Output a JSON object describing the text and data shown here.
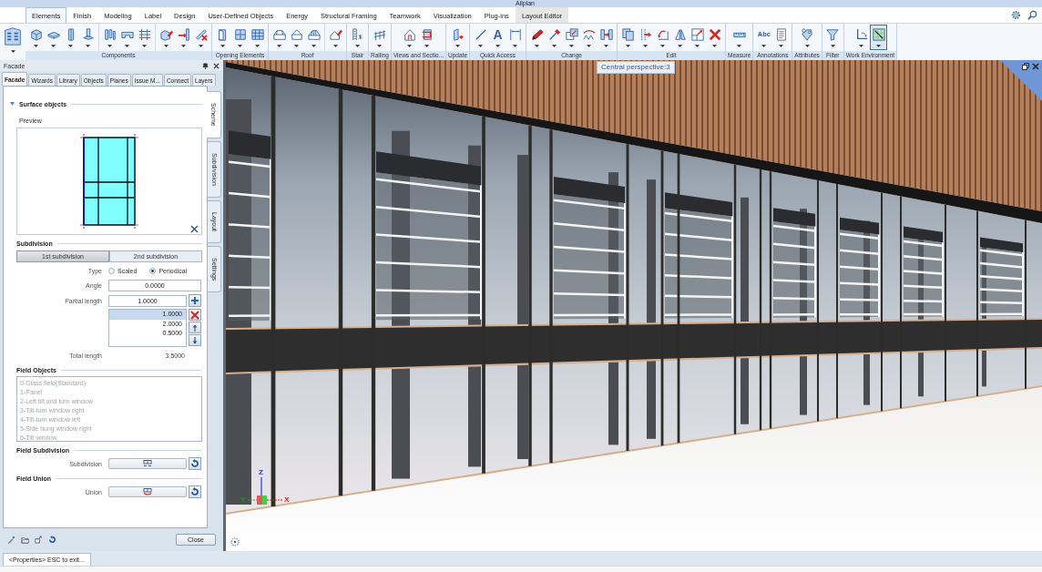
{
  "window": {
    "title": "Allplan"
  },
  "menu_tabs": [
    {
      "label": "Elements",
      "selected": true,
      "kind": "standard"
    },
    {
      "label": "Finish",
      "selected": false,
      "kind": "standard"
    },
    {
      "label": "Modeling",
      "selected": false,
      "kind": "standard"
    },
    {
      "label": "Label",
      "selected": false,
      "kind": "standard"
    },
    {
      "label": "Design",
      "selected": false,
      "kind": "standard"
    },
    {
      "label": "User-Defined Objects",
      "selected": false,
      "kind": "standard"
    },
    {
      "label": "Energy",
      "selected": false,
      "kind": "standard"
    },
    {
      "label": "Structural Framing",
      "selected": false,
      "kind": "standard"
    },
    {
      "label": "Teamwork",
      "selected": false,
      "kind": "standard"
    },
    {
      "label": "Visualization",
      "selected": false,
      "kind": "standard"
    },
    {
      "label": "Plug-ins",
      "selected": false,
      "kind": "standard"
    },
    {
      "label": "Layout Editor",
      "selected": false,
      "kind": "contextual"
    }
  ],
  "ribbon": {
    "groups": [
      {
        "label": "Components",
        "sets": [
          [
            {
              "selected": false
            },
            {
              "selected": false
            },
            {
              "selected": false
            },
            {
              "selected": false
            }
          ],
          [
            {
              "selected": false
            },
            {
              "selected": false
            },
            {
              "selected": false
            }
          ],
          [
            {
              "selected": false
            },
            {
              "selected": false
            },
            {
              "selected": false
            }
          ]
        ]
      },
      {
        "label": "Opening Elements",
        "sets": [
          [
            {
              "selected": false
            },
            {
              "selected": false
            },
            {
              "selected": false
            }
          ]
        ]
      },
      {
        "label": "Roof",
        "sets": [
          [
            {
              "selected": false
            },
            {
              "selected": false
            },
            {
              "selected": false
            }
          ],
          [
            {
              "selected": false
            }
          ]
        ]
      },
      {
        "label": "Stair",
        "sets": [
          [
            {
              "selected": false
            }
          ]
        ]
      },
      {
        "label": "Railing",
        "sets": [
          [
            {
              "selected": false
            }
          ]
        ]
      },
      {
        "label": "Views and Sectio...",
        "sets": [
          [
            {
              "selected": false
            },
            {
              "selected": false
            }
          ]
        ]
      },
      {
        "label": "Update",
        "sets": [
          [
            {
              "selected": false
            }
          ]
        ]
      },
      {
        "label": "Quick Access",
        "sets": [
          [
            {
              "selected": false
            },
            {
              "selected": false,
              "glyph": "A"
            },
            {
              "selected": false
            }
          ]
        ]
      },
      {
        "label": "Change",
        "sets": [
          [
            {
              "selected": false
            },
            {
              "selected": false
            },
            {
              "selected": false
            },
            {
              "selected": false
            },
            {
              "selected": false
            }
          ]
        ]
      },
      {
        "label": "Edit",
        "sets": [
          [
            {
              "selected": false
            },
            {
              "selected": false
            },
            {
              "selected": false
            },
            {
              "selected": false
            },
            {
              "selected": false
            },
            {
              "selected": false
            }
          ]
        ]
      },
      {
        "label": "Measure",
        "sets": [
          [
            {
              "selected": false
            }
          ]
        ]
      },
      {
        "label": "Annotations",
        "sets": [
          [
            {
              "selected": false,
              "glyph": "Abc"
            },
            {
              "selected": false
            }
          ]
        ]
      },
      {
        "label": "Attributes",
        "sets": [
          [
            {
              "selected": false
            }
          ]
        ]
      },
      {
        "label": "Filter",
        "sets": [
          [
            {
              "selected": false
            }
          ]
        ]
      },
      {
        "label": "Work Environment",
        "sets": [
          [
            {
              "selected": false
            },
            {
              "selected": true
            }
          ]
        ]
      }
    ]
  },
  "panel": {
    "title": "Facade",
    "tabs": [
      {
        "label": "Facade",
        "selected": true
      },
      {
        "label": "Wizards",
        "selected": false
      },
      {
        "label": "Library",
        "selected": false
      },
      {
        "label": "Objects",
        "selected": false
      },
      {
        "label": "Planes",
        "selected": false
      },
      {
        "label": "Issue M...",
        "selected": false
      },
      {
        "label": "Connect",
        "selected": false
      },
      {
        "label": "Layers",
        "selected": false
      }
    ],
    "side_tabs": [
      {
        "label": "Scheme",
        "selected": true
      },
      {
        "label": "Subdivision",
        "selected": false
      },
      {
        "label": "Layout",
        "selected": false
      },
      {
        "label": "Settings",
        "selected": false
      }
    ],
    "surface_objects": {
      "title": "Surface objects",
      "expanded": true,
      "preview_label": "Preview"
    },
    "subdivision": {
      "title": "Subdivision",
      "modes": [
        {
          "label": "1st subdivision",
          "selected": true
        },
        {
          "label": "2nd subdivision",
          "selected": false
        }
      ],
      "type_label": "Type",
      "type_options": [
        {
          "label": "Scaled",
          "selected": false
        },
        {
          "label": "Periodical",
          "selected": true
        }
      ],
      "angle": {
        "label": "Angle",
        "value": "0.0000"
      },
      "partial_length": {
        "label": "Partial length",
        "value": "1.0000"
      },
      "lengths": [
        {
          "value": "1.0000",
          "selected": true
        },
        {
          "value": "2.0000",
          "selected": false
        },
        {
          "value": "0.5000",
          "selected": false
        }
      ],
      "total_length": {
        "label": "Total length",
        "value": "3.5000"
      }
    },
    "field_objects": {
      "title": "Field Objects",
      "disabled": true,
      "items": [
        "0-Glass field(Standard)",
        "1-Panel",
        "2-Left tilt and turn window",
        "3-Tilt-turn window right",
        "4-Tilt-turn window left",
        "5-Side hung window right",
        "6-Tilt window"
      ]
    },
    "field_subdivision": {
      "title": "Field Subdivision",
      "label": "Subdivision"
    },
    "field_union": {
      "title": "Field Union",
      "label": "Union"
    },
    "close_label": "Close"
  },
  "viewport": {
    "view_label": "Central perspective:3",
    "axis_labels": {
      "z": "Z",
      "y": "Y",
      "x": "X"
    }
  },
  "command_bar": {
    "prompt": "<Properties> ESC to exit..."
  }
}
